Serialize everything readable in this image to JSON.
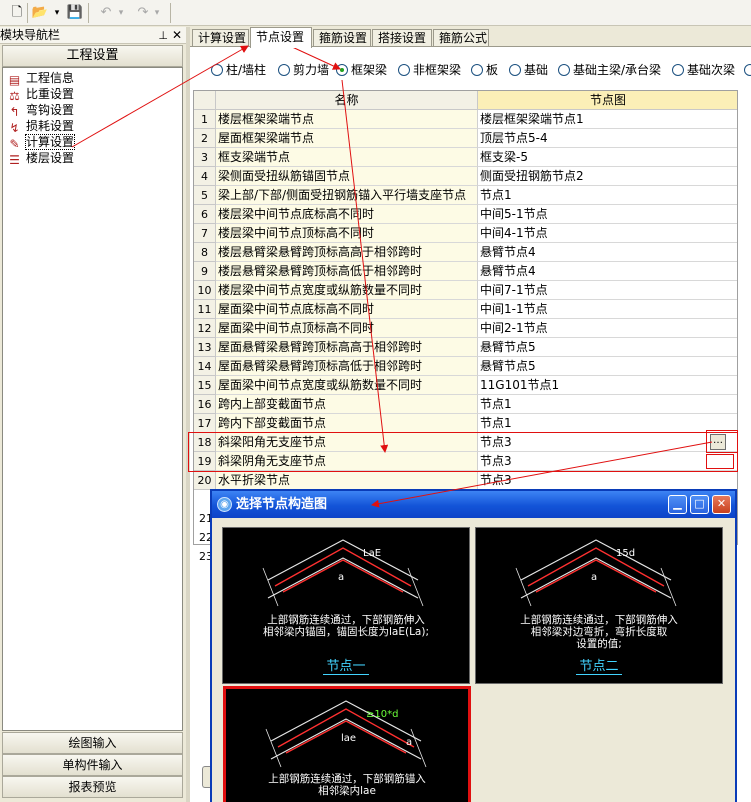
{
  "toolbar": {
    "buttons": [
      {
        "name": "new-file-icon",
        "glyph": "🗋",
        "enabled": true
      },
      {
        "name": "open-folder-icon",
        "glyph": "📂",
        "enabled": true
      },
      {
        "name": "dropdown-arrow-icon",
        "glyph": "▾",
        "enabled": true
      },
      {
        "name": "save-icon",
        "glyph": "💾",
        "enabled": true
      },
      {
        "name": "undo-icon",
        "glyph": "↶",
        "enabled": false
      },
      {
        "name": "undo-dropdown-icon",
        "glyph": "▾",
        "enabled": false
      },
      {
        "name": "redo-icon",
        "glyph": "↷",
        "enabled": false
      },
      {
        "name": "redo-dropdown-icon",
        "glyph": "▾",
        "enabled": false
      }
    ]
  },
  "nav": {
    "title": "模块导航栏",
    "pin_icon": "pin-icon",
    "close_icon": "close-icon",
    "project_button": "工程设置",
    "items": [
      {
        "label": "工程信息",
        "icon": "project-info-icon",
        "glyph": "▤"
      },
      {
        "label": "比重设置",
        "icon": "weight-setting-icon",
        "glyph": "⚖"
      },
      {
        "label": "弯钩设置",
        "icon": "hook-setting-icon",
        "glyph": "↰"
      },
      {
        "label": "损耗设置",
        "icon": "loss-setting-icon",
        "glyph": "↯"
      },
      {
        "label": "计算设置",
        "icon": "calc-setting-icon",
        "glyph": "✎"
      },
      {
        "label": "楼层设置",
        "icon": "floor-setting-icon",
        "glyph": "☰"
      }
    ],
    "bottom_buttons": [
      "绘图输入",
      "单构件输入",
      "报表预览"
    ]
  },
  "tabs": [
    "计算设置",
    "节点设置",
    "箍筋设置",
    "搭接设置",
    "箍筋公式"
  ],
  "active_tab": 1,
  "radios": [
    {
      "label": "柱/墙柱",
      "checked": false
    },
    {
      "label": "剪力墙",
      "checked": false
    },
    {
      "label": "框架梁",
      "checked": true
    },
    {
      "label": "非框架梁",
      "checked": false
    },
    {
      "label": "板",
      "checked": false
    },
    {
      "label": "基础",
      "checked": false
    },
    {
      "label": "基础主梁/承台梁",
      "checked": false
    },
    {
      "label": "基础次梁",
      "checked": false
    }
  ],
  "table": {
    "columns": [
      "名称",
      "节点图"
    ],
    "rows": [
      {
        "no": "1",
        "name": "楼层框架梁端节点",
        "node": "楼层框架梁端节点1"
      },
      {
        "no": "2",
        "name": "屋面框架梁端节点",
        "node": "顶层节点5-4"
      },
      {
        "no": "3",
        "name": "框支梁端节点",
        "node": "框支梁-5"
      },
      {
        "no": "4",
        "name": "梁侧面受扭纵筋锚固节点",
        "node": "侧面受扭钢筋节点2"
      },
      {
        "no": "5",
        "name": "梁上部/下部/侧面受扭钢筋锚入平行墙支座节点",
        "node": "节点1"
      },
      {
        "no": "6",
        "name": "楼层梁中间节点底标高不同时",
        "node": "中间5-1节点"
      },
      {
        "no": "7",
        "name": "楼层梁中间节点顶标高不同时",
        "node": "中间4-1节点"
      },
      {
        "no": "8",
        "name": "楼层悬臂梁悬臂跨顶标高高于相邻跨时",
        "node": "悬臂节点4"
      },
      {
        "no": "9",
        "name": "楼层悬臂梁悬臂跨顶标高低于相邻跨时",
        "node": "悬臂节点4"
      },
      {
        "no": "10",
        "name": "楼层梁中间节点宽度或纵筋数量不同时",
        "node": "中间7-1节点"
      },
      {
        "no": "11",
        "name": "屋面梁中间节点底标高不同时",
        "node": "中间1-1节点"
      },
      {
        "no": "12",
        "name": "屋面梁中间节点顶标高不同时",
        "node": "中间2-1节点"
      },
      {
        "no": "13",
        "name": "屋面悬臂梁悬臂跨顶标高高于相邻跨时",
        "node": "悬臂节点5"
      },
      {
        "no": "14",
        "name": "屋面悬臂梁悬臂跨顶标高低于相邻跨时",
        "node": "悬臂节点5"
      },
      {
        "no": "15",
        "name": "屋面梁中间节点宽度或纵筋数量不同时",
        "node": "11G101节点1"
      },
      {
        "no": "16",
        "name": "跨内上部变截面节点",
        "node": "节点1"
      },
      {
        "no": "17",
        "name": "跨内下部变截面节点",
        "node": "节点1"
      },
      {
        "no": "18",
        "name": "斜梁阳角无支座节点",
        "node": "节点3"
      },
      {
        "no": "19",
        "name": "斜梁阴角无支座节点",
        "node": "节点3"
      },
      {
        "no": "20",
        "name": "水平折梁节点",
        "node": "节点3"
      }
    ],
    "extra_row_numbers": [
      "21",
      "22",
      "23"
    ],
    "ellipsis": "…"
  },
  "dialog": {
    "title": "选择节点构造图",
    "min_icon": "minimize-icon",
    "max_icon": "maximize-icon",
    "close_icon": "close-icon",
    "thumbs": [
      {
        "caption": [
          "上部钢筋连续通过，下部钢筋伸入",
          "相邻梁内锚固，锚固长度为laE(La);"
        ],
        "name": "节点一",
        "labels": [
          "LaE",
          "a"
        ],
        "selected": false
      },
      {
        "caption": [
          "上部钢筋连续通过，下部钢筋伸入",
          "相邻梁对边弯折，弯折长度取",
          "设置的值;"
        ],
        "name": "节点二",
        "labels": [
          "15d",
          "a"
        ],
        "selected": false
      },
      {
        "caption": [
          "上部钢筋连续通过，下部钢筋锚入",
          "相邻梁内lae"
        ],
        "name": "",
        "labels": [
          "≥10*d",
          "lae",
          "a"
        ],
        "selected": true
      }
    ]
  },
  "colors": {
    "annotation_red": "#e01010",
    "radio_dot": "#21a121",
    "dialog_title": "#1354d8",
    "thumb_caption_name": "#42d4ff",
    "thumb_label_green": "#6cff3a"
  }
}
